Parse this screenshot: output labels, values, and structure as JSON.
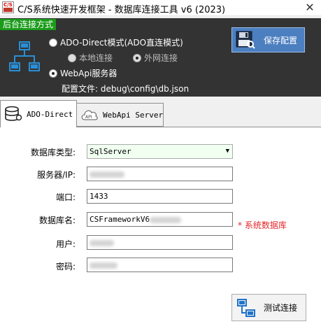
{
  "window": {
    "title": "C/S系统快速开发框架 - 数据库连接工具 v6 (2023)",
    "logo_text": "C/S",
    "close_glyph": "✕"
  },
  "panel": {
    "tag": "后台连接方式",
    "options": {
      "ado": {
        "label": "ADO-Direct模式(ADO直连模式)",
        "selected": false
      },
      "local": {
        "label": "本地连接",
        "selected": false,
        "disabled": true
      },
      "remote": {
        "label": "外网连接",
        "selected": true,
        "disabled": true
      },
      "webapi": {
        "label": "WebApi服务器",
        "selected": true
      }
    },
    "config_file": "配置文件: debug\\config\\db.json",
    "save_button": "保存配置",
    "icons": {
      "network": "network-icon",
      "save": "floppy-disk-icon"
    }
  },
  "tabs": [
    {
      "label": "ADO-Direct",
      "active": true,
      "icon": "database-icon"
    },
    {
      "label": "WebApi Server",
      "active": false,
      "icon": "cloud-api-icon"
    }
  ],
  "form": {
    "db_type": {
      "label": "数据库类型:",
      "value": "SqlServer"
    },
    "server": {
      "label": "服务器/IP:",
      "value": ""
    },
    "port": {
      "label": "端口:",
      "value": "1433"
    },
    "db_name": {
      "label": "数据库名:",
      "value": "CSFrameworkV6"
    },
    "user": {
      "label": "用户:",
      "value": ""
    },
    "password": {
      "label": "密码:",
      "value": ""
    },
    "note": "* 系统数据库"
  },
  "test_button": {
    "label": "测试连接",
    "icon": "network-test-icon"
  },
  "colors": {
    "panel_bg": "#333333",
    "tag_green": "#1a9c1a",
    "save_blue": "#4c7fc0",
    "note_red": "#e3262a",
    "combo_bg": "#f0fff0"
  }
}
